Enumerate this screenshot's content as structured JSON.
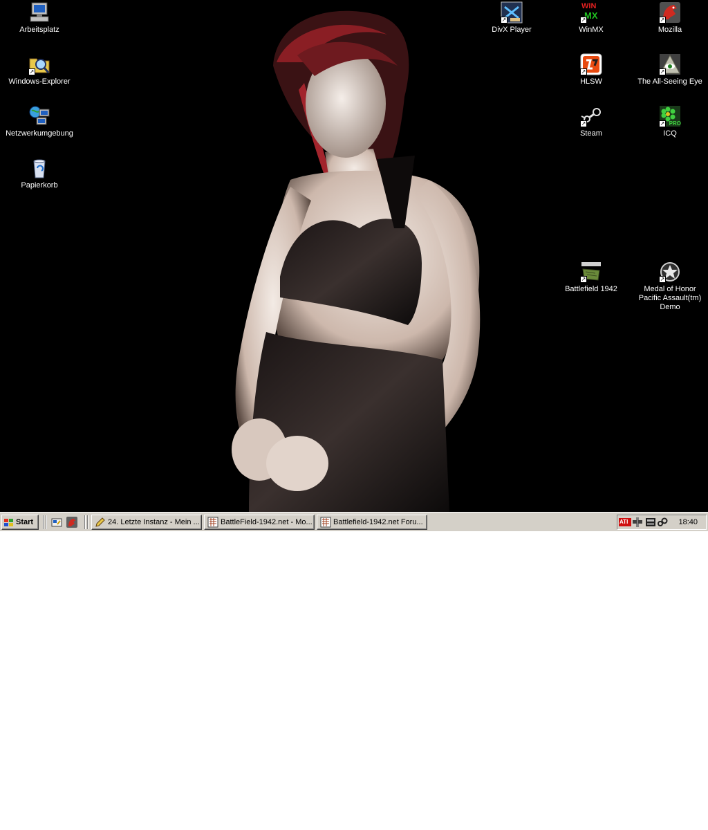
{
  "desktop_icons": {
    "arbeitsplatz": "Arbeitsplatz",
    "windows_explorer": "Windows-Explorer",
    "netzwerkumgebung": "Netzwerkumgebung",
    "papierkorb": "Papierkorb",
    "divx_player": "DivX Player",
    "winmx": "WinMX",
    "mozilla": "Mozilla",
    "hlsw": "HLSW",
    "all_seeing_eye": "The All-Seeing Eye",
    "steam": "Steam",
    "icq": "ICQ",
    "battlefield": "Battlefield 1942",
    "medal_of_honor": "Medal of Honor Pacific Assault(tm) Demo"
  },
  "taskbar": {
    "start_label": "Start",
    "tasks": [
      {
        "label": "24. Letzte Instanz - Mein ..."
      },
      {
        "label": "BattleField-1942.net - Mo..."
      },
      {
        "label": "Battlefield-1942.net Foru..."
      }
    ],
    "clock": "18:40"
  },
  "icon_glyphs": {
    "winmx_top": "WIN",
    "winmx_bottom": "MX",
    "icq_badge": "PRO",
    "ati": "ATI"
  },
  "colors": {
    "desktop": "#000000",
    "taskbar": "#d4d0c8",
    "hair": "#8a1e24",
    "skin": "#e9dcd4"
  }
}
